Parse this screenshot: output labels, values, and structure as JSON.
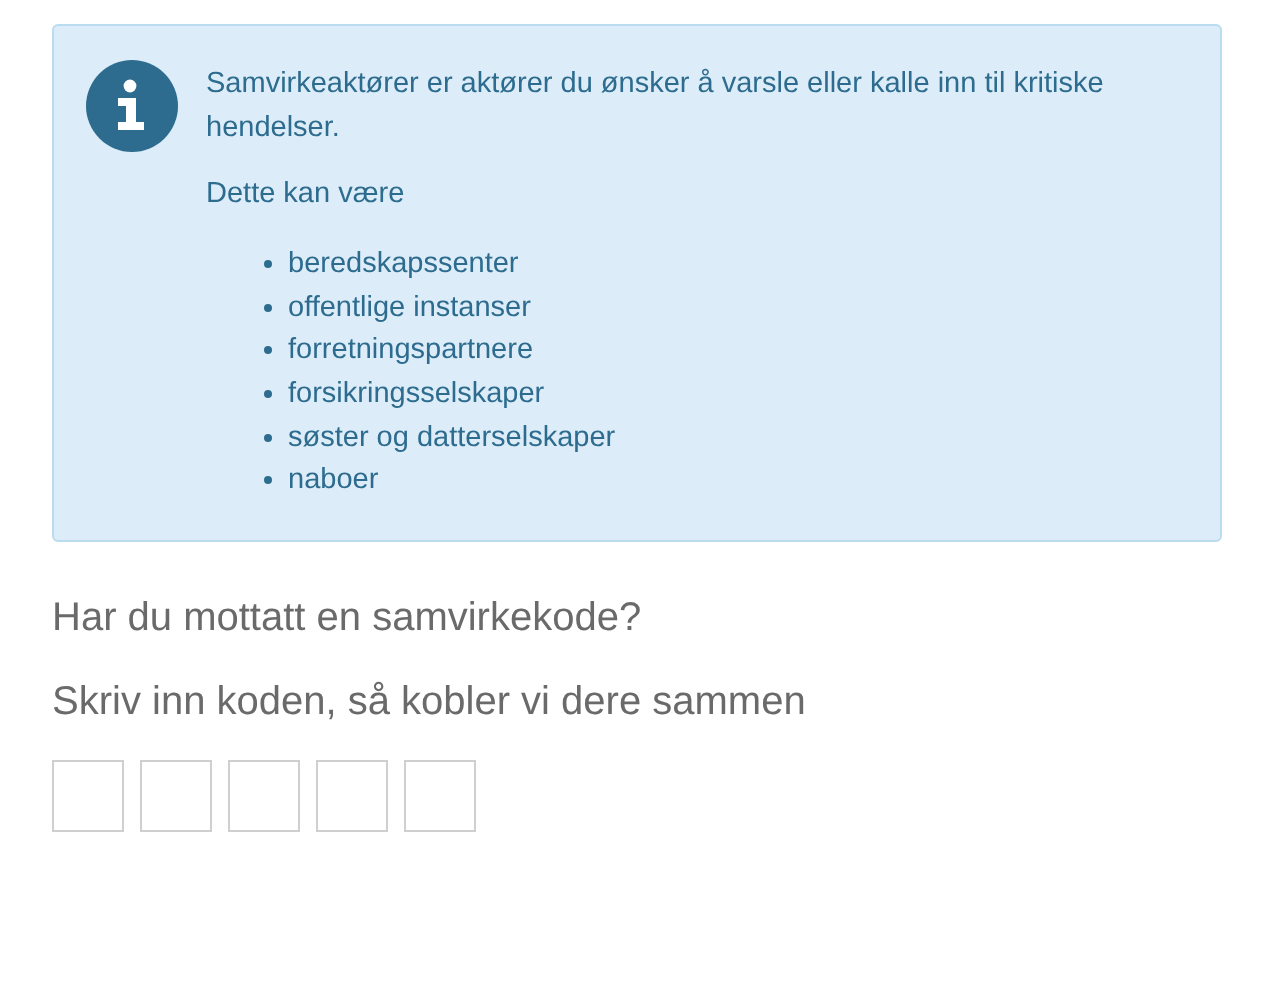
{
  "info_box": {
    "paragraphs": [
      "Samvirkeaktører er aktører du ønsker å varsle eller kalle inn til kritiske hendelser.",
      "Dette kan være"
    ],
    "list": [
      "beredskapssenter",
      "offentlige instanser",
      "forretningspartnere",
      "forsikringsselskaper",
      "søster og datterselskaper",
      "naboer"
    ]
  },
  "heading": "Har du mottatt en samvirkekode?",
  "subheading": "Skriv inn koden, så kobler vi dere sammen",
  "code_fields": [
    {
      "kind": "digit"
    },
    {
      "kind": "digit"
    },
    {
      "kind": "digit"
    },
    {
      "kind": "digit"
    },
    {
      "kind": "digit"
    }
  ]
}
